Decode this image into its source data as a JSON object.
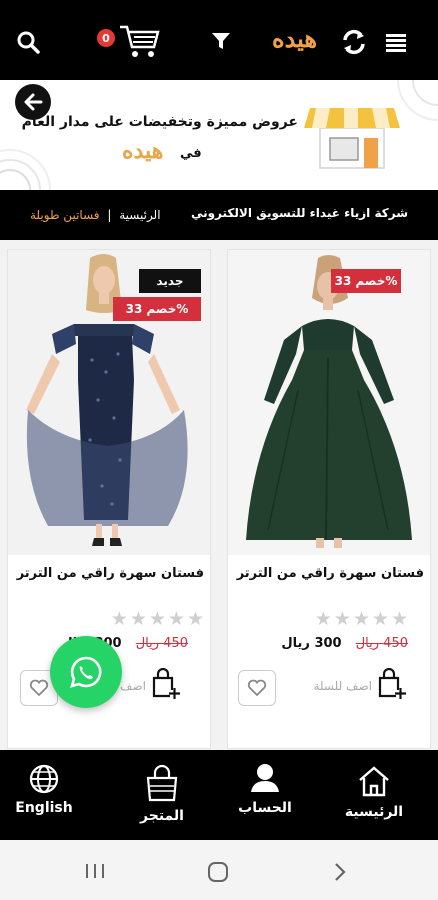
{
  "header": {
    "cart_count": "0",
    "logo_text": "هيده",
    "icons": [
      "search-icon",
      "cart-icon",
      "filter-icon",
      "refresh-icon",
      "menu-icon"
    ]
  },
  "banner": {
    "headline": "عروض مميزة وتخفيضات على مدار العام",
    "in_text": "في",
    "logo_text": "هيده"
  },
  "breadcrumb": {
    "company": "شركة ازياء غيداء للتسويق الالكتروني",
    "home": "الرئيسية",
    "separator": "|",
    "current": "فساتين طويلة"
  },
  "products": [
    {
      "name": "فستان سهرة راقي من الترتر",
      "badge_sale": "خصم 33%",
      "old_price": "450 ريال",
      "price": "300 ريال",
      "add_label": "اضف للسلة",
      "rating": 0,
      "dress_color": "#1f3a2e"
    },
    {
      "name": "فستان سهرة راقي من الترتر",
      "badge_new": "جديد",
      "badge_sale": "خصم 33%",
      "old_price": "450 ريال",
      "price": "300 ريال",
      "add_label": "اضف للسلة",
      "rating": 0,
      "dress_color": "#263552"
    }
  ],
  "bottom_nav": {
    "home": "الرئيسية",
    "account": "الحساب",
    "store": "المتجر",
    "language": "English"
  },
  "colors": {
    "accent": "#f0a24a",
    "sale_red": "#d32f3c",
    "whatsapp": "#25d366"
  }
}
